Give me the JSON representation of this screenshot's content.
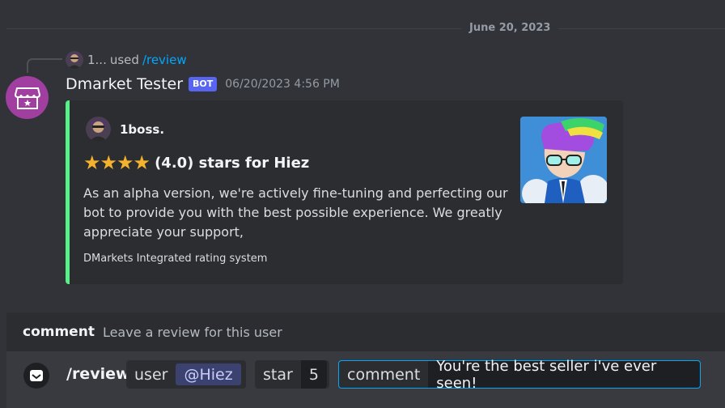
{
  "chat": {
    "date_divider": "June 20, 2023"
  },
  "message": {
    "reply": {
      "username": "1...",
      "used_text": "used",
      "command": "/review"
    },
    "author": "Dmarket Tester",
    "bot_tag": "BOT",
    "timestamp": "06/20/2023 4:56 PM",
    "avatar_icon": "store-icon",
    "embed": {
      "color": "#57f287",
      "author_name": "1boss.",
      "rating": 4,
      "rating_max": 5,
      "title": "(4.0) stars for Hiez",
      "description": "As an alpha version, we're actively fine-tuning and perfecting our bot to provide you with the best possible experience. We greatly appreciate your support,",
      "footer": "DMarkets Integrated rating system"
    }
  },
  "command_hint": {
    "option_name": "comment",
    "option_description": "Leave a review for this user"
  },
  "input": {
    "app_icon": "inbox-icon",
    "command": "/review",
    "options": {
      "user_label": "user",
      "user_value": "@Hiez",
      "star_label": "star",
      "star_value": "5",
      "comment_label": "comment",
      "comment_value": "You're the best seller i've ever seen!"
    }
  }
}
